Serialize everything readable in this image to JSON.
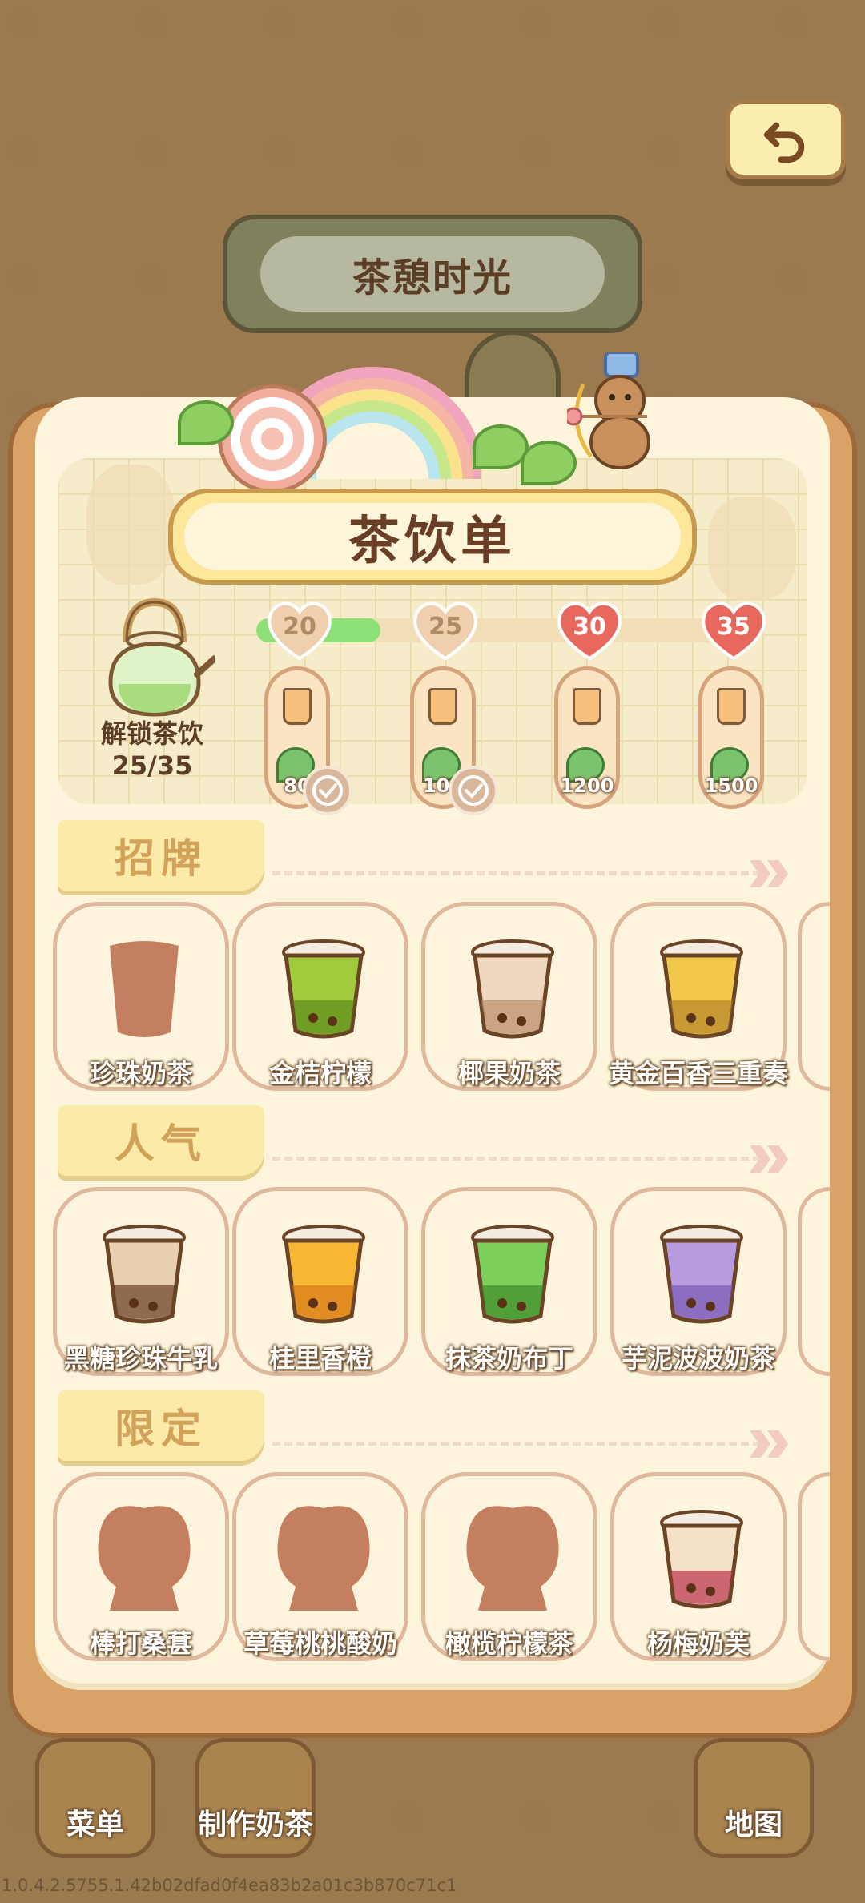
{
  "header": {
    "sign_title": "茶憩时光",
    "back_icon": "undo-arrow-icon"
  },
  "panel": {
    "title": "茶饮单",
    "unlock_label": "解锁茶饮",
    "unlock_count": "25/35",
    "progress_fraction": 0.25
  },
  "milestones": [
    {
      "level": "20",
      "reward": "80",
      "claimed": true
    },
    {
      "level": "25",
      "reward": "100",
      "claimed": true
    },
    {
      "level": "30",
      "reward": "1200",
      "claimed": false
    },
    {
      "level": "35",
      "reward": "1500",
      "claimed": false
    }
  ],
  "sections": [
    {
      "title": "招牌",
      "items": [
        {
          "name": "珍珠奶茶",
          "locked": true,
          "icon": "cup-silhouette-icon"
        },
        {
          "name": "金桔柠檬",
          "locked": false,
          "icon": "kumquat-lemon-drink-icon"
        },
        {
          "name": "椰果奶茶",
          "locked": false,
          "icon": "coconut-milk-tea-icon"
        },
        {
          "name": "黄金百香三重奏",
          "locked": false,
          "icon": "golden-passionfruit-drink-icon"
        }
      ]
    },
    {
      "title": "人气",
      "items": [
        {
          "name": "黑糖珍珠牛乳",
          "locked": false,
          "icon": "brown-sugar-boba-icon"
        },
        {
          "name": "桂里香橙",
          "locked": false,
          "icon": "osmanthus-orange-icon"
        },
        {
          "name": "抹茶奶布丁",
          "locked": false,
          "icon": "matcha-pudding-icon"
        },
        {
          "name": "芋泥波波奶茶",
          "locked": false,
          "icon": "taro-boba-icon"
        }
      ]
    },
    {
      "title": "限定",
      "items": [
        {
          "name": "棒打桑葚",
          "locked": true,
          "icon": "locked-silhouette-icon"
        },
        {
          "name": "草莓桃桃酸奶",
          "locked": true,
          "icon": "locked-silhouette-icon"
        },
        {
          "name": "橄榄柠檬茶",
          "locked": true,
          "icon": "locked-silhouette-icon"
        },
        {
          "name": "杨梅奶芙",
          "locked": false,
          "icon": "bayberry-cream-icon"
        }
      ]
    }
  ],
  "bottom_nav": {
    "menu": "菜单",
    "make_tea": "制作奶茶",
    "map": "地图"
  },
  "version": "1.0.4.2.5755.1.42b02dfad0f4ea83b2a01c3b870c71c1",
  "colors": {
    "background": "#9c7a50",
    "panel": "#fcf5dc",
    "progress": "#8de078",
    "heart_active": "#e8685e",
    "heart_inactive": "#efcfae"
  }
}
